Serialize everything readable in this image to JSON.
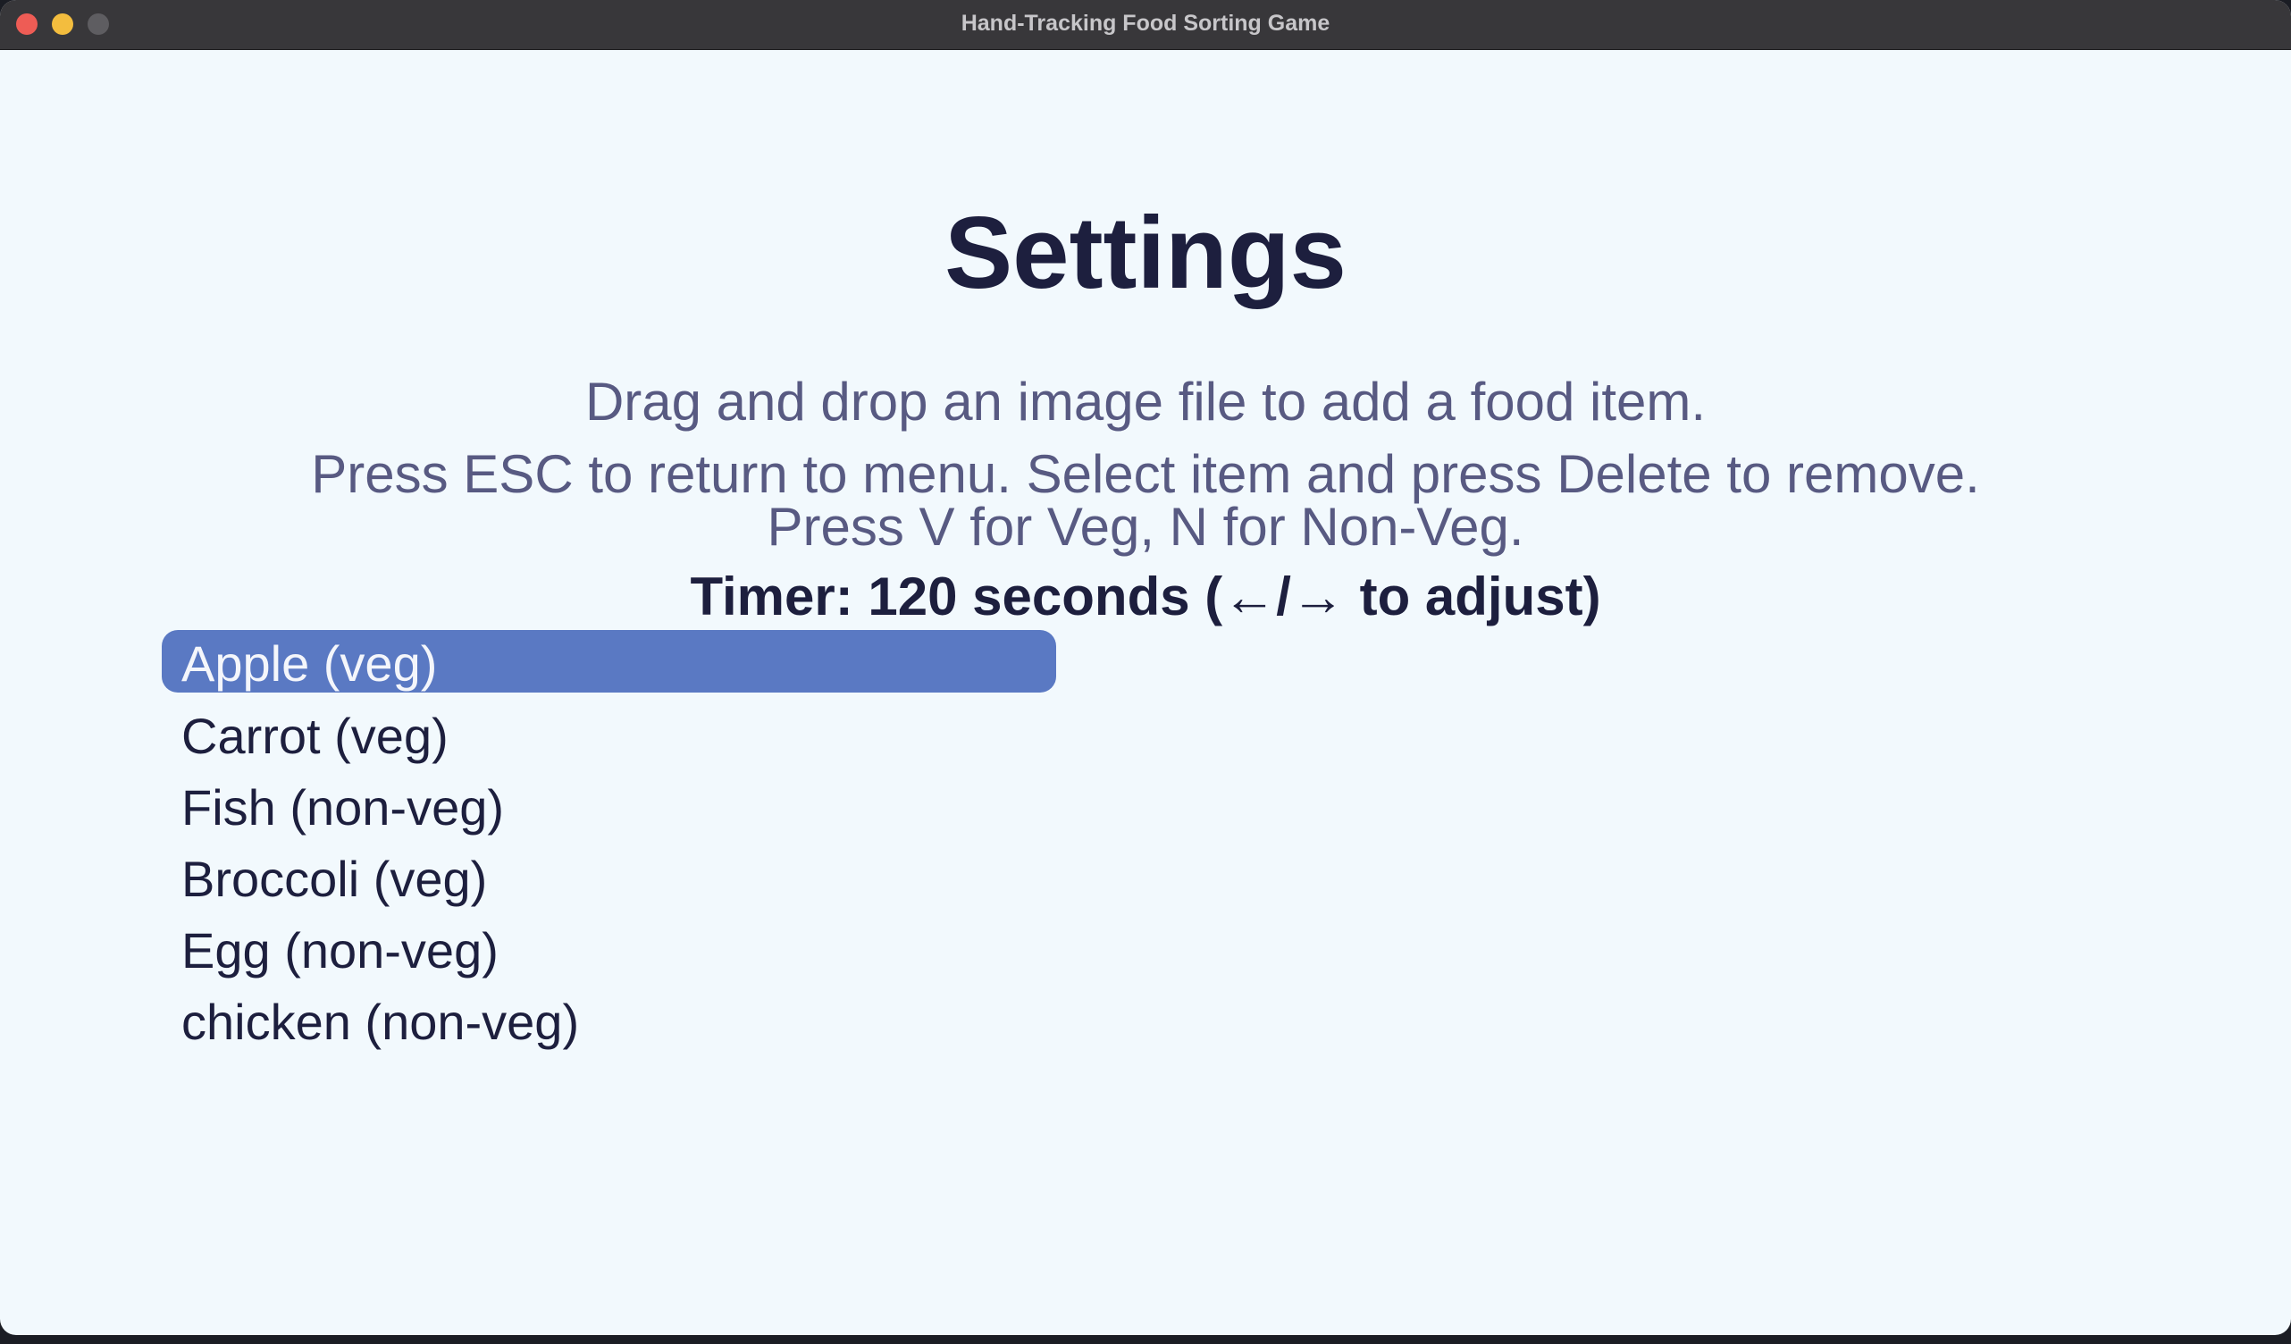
{
  "window": {
    "title": "Hand-Tracking Food Sorting Game"
  },
  "settings": {
    "title": "Settings",
    "instructions": [
      "Drag and drop an image file to add a food item.",
      "Press ESC to return to menu. Select item and press Delete to remove.",
      "Press V for Veg, N for Non-Veg."
    ],
    "timer_text": "Timer: 120 seconds  (←/→ to adjust)",
    "selected_index": 0,
    "food_items": [
      "Apple (veg)",
      "Carrot (veg)",
      "Fish (non-veg)",
      "Broccoli (veg)",
      "Egg (non-veg)",
      "chicken (non-veg)"
    ]
  },
  "colors": {
    "background": "#f2f9fd",
    "title": "#1d1f3e",
    "instruction_text": "#585a82",
    "selection": "#5a79c3"
  }
}
